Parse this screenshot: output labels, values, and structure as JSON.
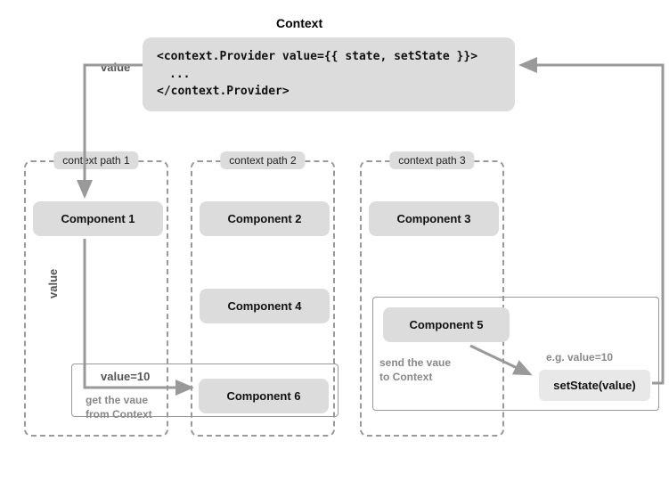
{
  "title": "Context",
  "context_code": {
    "line1": "<context.Provider value={{ state, setState }}>",
    "line2": "  ...",
    "line3": "</context.Provider>"
  },
  "labels": {
    "value_top": "value",
    "path1": "context path 1",
    "path2": "context path 2",
    "path3": "context path 3",
    "value_left": "value",
    "value10": "value=10",
    "get_value": "get the vaue\nfrom Context",
    "send_value": "send the vaue\nto Context",
    "eg_value": "e.g. value=10"
  },
  "components": {
    "c1": "Component 1",
    "c2": "Component 2",
    "c3": "Component 3",
    "c4": "Component 4",
    "c5": "Component 5",
    "c6": "Component 6",
    "setstate": "setState(value)"
  }
}
